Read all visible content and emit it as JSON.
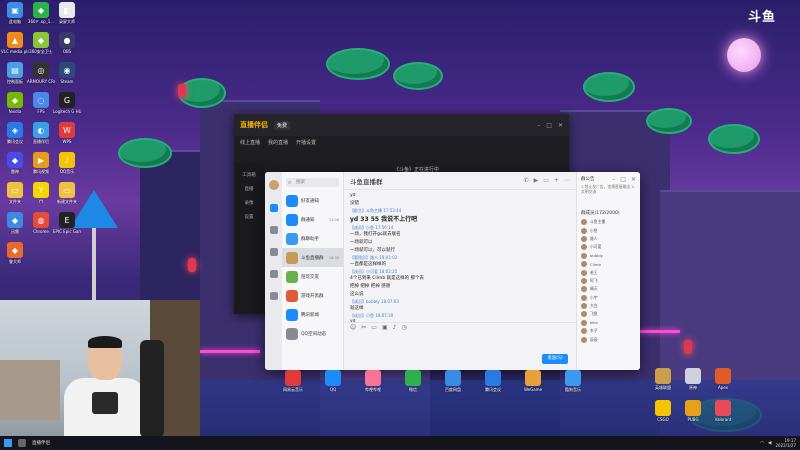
{
  "brand": {
    "logo_text": "斗鱼"
  },
  "desktop_icons": [
    {
      "label": "此电脑",
      "color": "#3a8ee6",
      "glyph": "▣"
    },
    {
      "label": "360Ｆ.xp_1...",
      "color": "#2bb24c",
      "glyph": "◆"
    },
    {
      "label": "录屏大师",
      "color": "#e8e8e8",
      "glyph": "◧"
    },
    {
      "label": "VLC media player",
      "color": "#f08a1a",
      "glyph": "▲"
    },
    {
      "label": "360安全卫士",
      "color": "#8ac43a",
      "glyph": "◆"
    },
    {
      "label": "OBS",
      "color": "#3a3a6a",
      "glyph": "●"
    },
    {
      "label": "控制面板",
      "color": "#4aa0e6",
      "glyph": "▤"
    },
    {
      "label": "ARMOURY CRATE",
      "color": "#333",
      "glyph": "◎"
    },
    {
      "label": "Steam",
      "color": "#2a4a7a",
      "glyph": "◉"
    },
    {
      "label": "Nvidia",
      "color": "#76b900",
      "glyph": "◆"
    },
    {
      "label": "FPS",
      "color": "#4a8ae6",
      "glyph": "◌"
    },
    {
      "label": "Logitech G HUB",
      "color": "#222",
      "glyph": "G"
    },
    {
      "label": "腾讯会议",
      "color": "#2a7ae6",
      "glyph": "◈"
    },
    {
      "label": "直播伴侣",
      "color": "#3aa0e6",
      "glyph": "◐"
    },
    {
      "label": "WPS",
      "color": "#e03a3a",
      "glyph": "W"
    },
    {
      "label": "雷神",
      "color": "#4a4ae6",
      "glyph": "◆"
    },
    {
      "label": "腾讯视频",
      "color": "#e89a1a",
      "glyph": "▶"
    },
    {
      "label": "QQ音乐",
      "color": "#f5c400",
      "glyph": "♪"
    },
    {
      "label": "文件夹",
      "color": "#f0c040",
      "glyph": "▭"
    },
    {
      "label": "YY",
      "color": "#f5d400",
      "glyph": "Y"
    },
    {
      "label": "新建文件夹",
      "color": "#f0c040",
      "glyph": "▭"
    },
    {
      "label": "迅雷",
      "color": "#3a8ae6",
      "glyph": "◆"
    },
    {
      "label": "Chrome",
      "color": "#e84a3a",
      "glyph": "◍"
    },
    {
      "label": "EPIC Epic Games",
      "color": "#222",
      "glyph": "E"
    },
    {
      "label": "鲁大师",
      "color": "#e86a2a",
      "glyph": "◆"
    }
  ],
  "bg_app": {
    "logo": "直播伴侣",
    "tag": "免费",
    "tabs": [
      "线上直播",
      "我的直播",
      "开播设置"
    ],
    "sidebar": [
      "工具箱",
      "直播",
      "录像",
      "设置"
    ],
    "banner": "《斗鱼》正在进行中"
  },
  "qq": {
    "search_placeholder": "搜索",
    "conversations": [
      {
        "name": "好友通知",
        "color": "#1a8cff",
        "badge": ""
      },
      {
        "name": "群通知",
        "color": "#1a8cff",
        "badge": "13:06"
      },
      {
        "name": "群聊助手",
        "color": "#3a9af0",
        "badge": ""
      },
      {
        "name": "斗鱼直播群",
        "color": "#c89a5a",
        "badge": "18:30"
      },
      {
        "name": "陪玩交友",
        "color": "#6ab04c",
        "badge": ""
      },
      {
        "name": "游戏开黑群",
        "color": "#e05a3a",
        "badge": ""
      },
      {
        "name": "腾讯新闻",
        "color": "#1a8cff",
        "badge": ""
      },
      {
        "name": "QQ空间动态",
        "color": "#8a8a96",
        "badge": ""
      }
    ],
    "chat_title": "斗鱼直播群",
    "messages": [
      {
        "who": "",
        "txt": "yd",
        "big": false
      },
      {
        "who": "",
        "txt": "没错",
        "big": false
      },
      {
        "who": "【群主】斗鱼主播 17:53:44",
        "txt": "yd 33 55 我说不上行吧",
        "big": true
      },
      {
        "who": "【成员】小鱼 17:56:14",
        "txt": "一场，我打开go就去联名",
        "big": false
      },
      {
        "who": "",
        "txt": "一场就可以",
        "big": false
      },
      {
        "who": "",
        "txt": "一场就可以，可以就行",
        "big": false
      },
      {
        "who": "【管理员】路人 18:01:02",
        "txt": "一直都是这样样的",
        "big": false
      },
      {
        "who": "【成员】小可爱 18:02:25",
        "txt": "4个已到来 Climb 就是这样的 那个去",
        "big": false
      },
      {
        "who": "",
        "txt": "把掉 把掉 把掉 感谢",
        "big": false
      },
      {
        "who": "",
        "txt": "这么说",
        "big": false
      },
      {
        "who": "【成员】bubbly 18:07:03",
        "txt": "就这样",
        "big": false
      },
      {
        "who": "【成员】小鱼 18:07:30",
        "txt": "yd",
        "big": false
      }
    ],
    "send_label": "发送(S)",
    "members_title": "群公告",
    "notice": "1.禁止发广告，违规直接踢出 2.文明交流",
    "member_count": "群成员(172/2000)",
    "members": [
      "斗鱼主播",
      "小鱼",
      "路人",
      "小可爱",
      "bubbly",
      "Climb",
      "老王",
      "阿飞",
      "晴天",
      "小宇",
      "大白",
      "飞鱼",
      "kiko",
      "木子",
      "辰辰"
    ]
  },
  "taskbar": {
    "active_app": "直播伴侣",
    "time": "19:17",
    "date": "2022/1/27"
  },
  "dock_icons": [
    {
      "label": "网易云音乐",
      "color": "#e03a3a"
    },
    {
      "label": "QQ",
      "color": "#1a8cff"
    },
    {
      "label": "哔哩哔哩",
      "color": "#fb7299"
    },
    {
      "label": "微信",
      "color": "#2bb24c"
    },
    {
      "label": "百度网盘",
      "color": "#3a8ae6"
    },
    {
      "label": "腾讯会议",
      "color": "#2a7ae6"
    },
    {
      "label": "WeGame",
      "color": "#e8a03a"
    },
    {
      "label": "酷狗音乐",
      "color": "#3a9af0"
    }
  ],
  "right_icons": [
    {
      "label": "英雄联盟",
      "color": "#c8a050"
    },
    {
      "label": "原神",
      "color": "#d0d0e0"
    },
    {
      "label": "Apex",
      "color": "#e05a2a"
    },
    {
      "label": "CSGO",
      "color": "#f5c400"
    },
    {
      "label": "PUBG",
      "color": "#e8a01a"
    },
    {
      "label": "Valorant",
      "color": "#e84a5a"
    }
  ]
}
